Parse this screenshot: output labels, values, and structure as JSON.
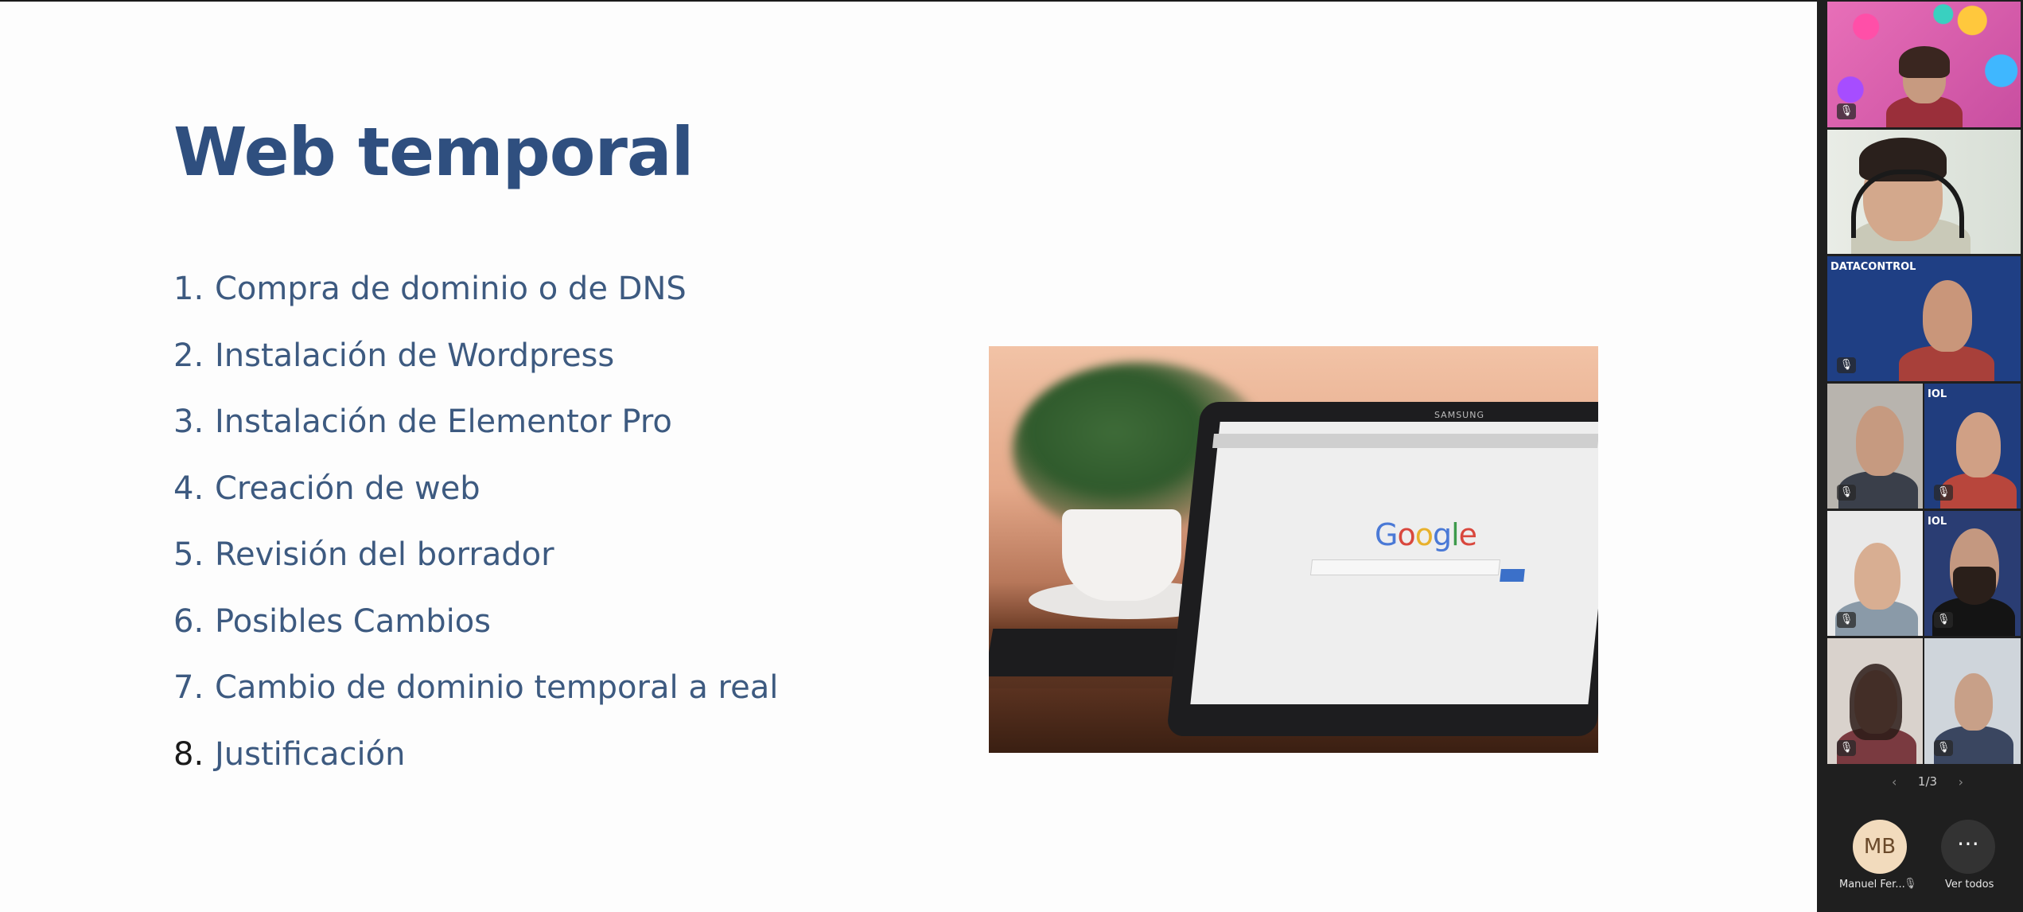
{
  "slide": {
    "title": "Web temporal",
    "items": [
      {
        "num": "1.",
        "text": "Compra de dominio o de DNS"
      },
      {
        "num": "2.",
        "text": "Instalación de Wordpress"
      },
      {
        "num": "3.",
        "text": "Instalación de Elementor Pro"
      },
      {
        "num": "4.",
        "text": "Creación de web"
      },
      {
        "num": "5.",
        "text": "Revisión del borrador"
      },
      {
        "num": "6.",
        "text": "Posibles Cambios"
      },
      {
        "num": "7.",
        "text": "Cambio de dominio temporal a real"
      },
      {
        "num": "8.",
        "text": "Justificación"
      }
    ],
    "photo": {
      "google_letters": [
        "G",
        "o",
        "o",
        "g",
        "l",
        "e"
      ],
      "brand": "SAMSUNG"
    }
  },
  "sidebar": {
    "tile_logo": "DATACONTROL",
    "tile_logo_short": "IOL",
    "pager": {
      "label": "1/3",
      "prev": "‹",
      "next": "›"
    },
    "self": {
      "initials": "MB",
      "name": "Manuel Fer...",
      "mic_icon": "🎙"
    },
    "more": {
      "icon": "⋯",
      "label": "Ver todos"
    },
    "mic_glyph": "🎙"
  },
  "colors": {
    "title": "#2f4f7f",
    "list_text": "#3d5a80",
    "sidebar_bg": "#1f1f1f",
    "avatar_bg": "#f2dbbd"
  }
}
